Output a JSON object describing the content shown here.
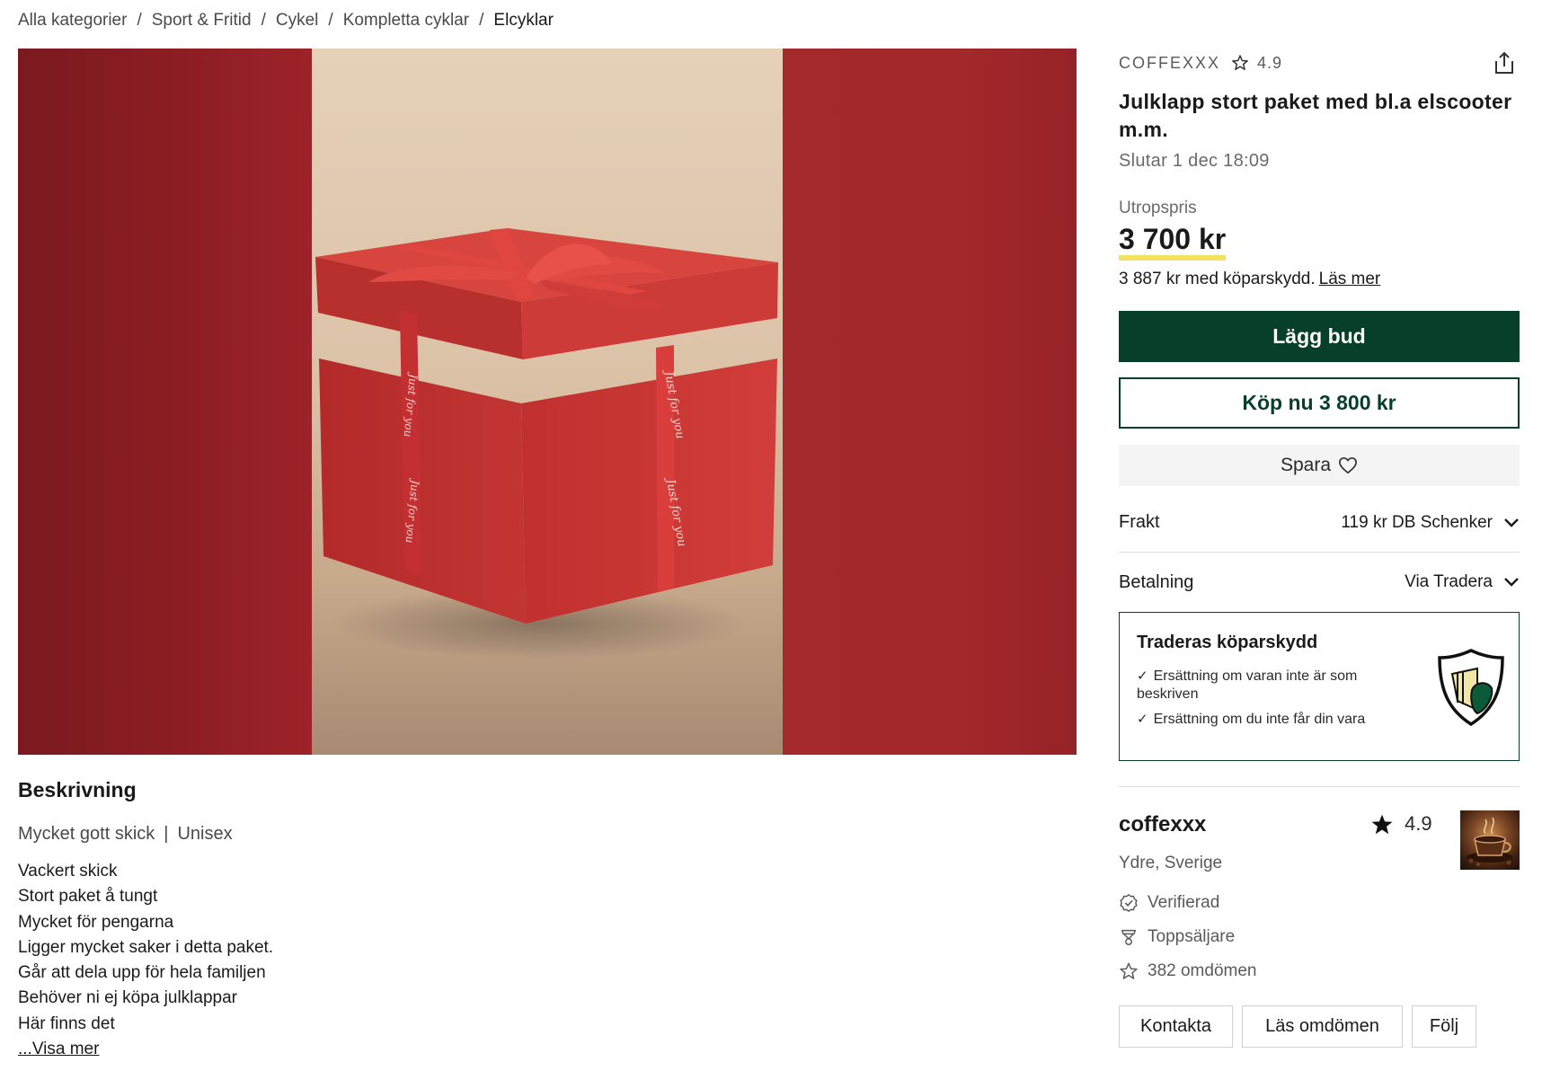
{
  "breadcrumb": [
    "Alla kategorier",
    "Sport & Fritid",
    "Cykel",
    "Kompletta cyklar",
    "Elcyklar"
  ],
  "breadcrumb_separator": "/",
  "seller_top": {
    "name": "COFFEXXX",
    "rating": "4.9"
  },
  "listing": {
    "title": "Julklapp stort paket med bl.a elscooter m.m.",
    "ends": "Slutar 1 dec 18:09",
    "price_label": "Utropspris",
    "price": "3 700 kr",
    "protection_price": "3 887 kr med köparskydd.",
    "read_more": "Läs mer"
  },
  "actions": {
    "bid_label": "Lägg bud",
    "buy_label": "Köp nu 3 800 kr",
    "save_label": "Spara"
  },
  "shipping": {
    "label": "Frakt",
    "value": "119 kr DB Schenker"
  },
  "payment": {
    "label": "Betalning",
    "value": "Via Tradera"
  },
  "protection": {
    "title": "Traderas köparskydd",
    "items": [
      "Ersättning om varan inte är som beskriven",
      "Ersättning om du inte får din vara"
    ]
  },
  "seller": {
    "name": "coffexxx",
    "rating": "4.9",
    "location": "Ydre, Sverige",
    "verified": "Verifierad",
    "top_seller": "Toppsäljare",
    "reviews": "382 omdömen",
    "contact": "Kontakta",
    "read_reviews": "Läs omdömen",
    "follow": "Följ"
  },
  "description": {
    "title": "Beskrivning",
    "condition": "Mycket gott skick",
    "gender": "Unisex",
    "meta_separator": "|",
    "lines": [
      "Vackert skick",
      "Stort paket å tungt",
      "Mycket för pengarna",
      "Ligger mycket saker i detta paket.",
      "Går att dela upp för hela familjen",
      "Behöver ni ej köpa julklappar",
      "Här finns det"
    ],
    "show_more": "...Visa mer"
  },
  "image": {
    "ribbon_text": "Just for you"
  },
  "colors": {
    "accent": "#083f2b",
    "price_underline": "#f4e25c",
    "box_red": "#c8363a"
  },
  "icons": {
    "rating": "star-icon",
    "share": "share-icon",
    "save": "heart-icon",
    "dropdown": "chevron-down-icon",
    "check": "check-icon",
    "protection": "shield-icon",
    "verified": "verified-badge-icon",
    "top_seller": "trophy-icon",
    "reviews": "star-outline-icon"
  }
}
